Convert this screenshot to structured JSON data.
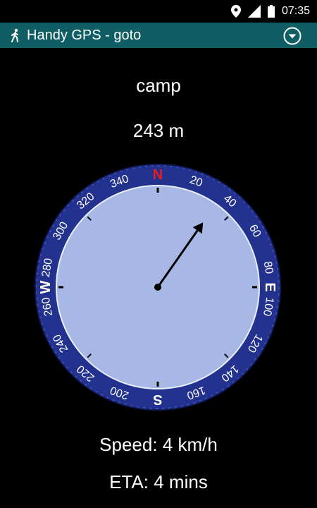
{
  "status_bar": {
    "time": "07:35",
    "icons": [
      "location-pin-icon",
      "signal-icon",
      "battery-icon"
    ]
  },
  "app_bar": {
    "title": "Handy GPS - goto",
    "app_icon": "hiker-icon",
    "menu_icon": "dropdown-circle-icon",
    "color": "#0f5e63"
  },
  "target": {
    "name": "camp",
    "distance": "243 m"
  },
  "compass": {
    "bezel_color": "#23318f",
    "face_color": "#a8b8e6",
    "north_color": "#e02020",
    "bearing_to_target_deg": 35,
    "labels": [
      {
        "text": "N",
        "angle": 0,
        "cardinal": true
      },
      {
        "text": "20",
        "angle": 20
      },
      {
        "text": "40",
        "angle": 40
      },
      {
        "text": "60",
        "angle": 60
      },
      {
        "text": "80",
        "angle": 80
      },
      {
        "text": "E",
        "angle": 90,
        "cardinal": true
      },
      {
        "text": "100",
        "angle": 100
      },
      {
        "text": "120",
        "angle": 120
      },
      {
        "text": "140",
        "angle": 140
      },
      {
        "text": "160",
        "angle": 160
      },
      {
        "text": "S",
        "angle": 180,
        "cardinal": true
      },
      {
        "text": "200",
        "angle": 200
      },
      {
        "text": "220",
        "angle": 220
      },
      {
        "text": "240",
        "angle": 240
      },
      {
        "text": "260",
        "angle": 260
      },
      {
        "text": "W",
        "angle": 270,
        "cardinal": true
      },
      {
        "text": "280",
        "angle": 280
      },
      {
        "text": "300",
        "angle": 300
      },
      {
        "text": "320",
        "angle": 320
      },
      {
        "text": "340",
        "angle": 340
      }
    ]
  },
  "info": {
    "speed": "Speed: 4 km/h",
    "eta": "ETA: 4 mins"
  }
}
